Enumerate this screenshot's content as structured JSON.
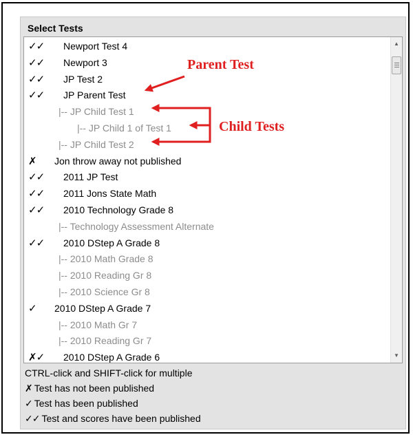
{
  "panel": {
    "title": "Select Tests"
  },
  "tests": [
    {
      "mark": "✓✓",
      "label": "Newport Test 4",
      "level": "parent"
    },
    {
      "mark": "✓✓",
      "label": "Newport 3",
      "level": "parent"
    },
    {
      "mark": "✓✓",
      "label": "JP Test 2",
      "level": "parent"
    },
    {
      "mark": "✓✓",
      "label": "JP Parent Test",
      "level": "parent"
    },
    {
      "mark": "",
      "label": "|-- JP Child Test 1",
      "level": "child1"
    },
    {
      "mark": "",
      "label": "|-- JP Child 1 of Test 1",
      "level": "child2"
    },
    {
      "mark": "",
      "label": "|-- JP Child Test 2",
      "level": "child1"
    },
    {
      "mark": "✗",
      "label": "Jon throw away not published",
      "level": "single"
    },
    {
      "mark": "✓✓",
      "label": "2011 JP Test",
      "level": "parent"
    },
    {
      "mark": "✓✓",
      "label": "2011 Jons State Math",
      "level": "parent"
    },
    {
      "mark": "✓✓",
      "label": "2010 Technology Grade 8",
      "level": "parent"
    },
    {
      "mark": "",
      "label": "|-- Technology Assessment Alternate",
      "level": "child1"
    },
    {
      "mark": "✓✓",
      "label": "2010 DStep A Grade 8",
      "level": "parent"
    },
    {
      "mark": "",
      "label": "|-- 2010 Math Grade 8",
      "level": "child1"
    },
    {
      "mark": "",
      "label": "|-- 2010 Reading Gr 8",
      "level": "child1"
    },
    {
      "mark": "",
      "label": "|-- 2010 Science Gr 8",
      "level": "child1"
    },
    {
      "mark": "✓",
      "label": "2010 DStep A Grade 7",
      "level": "single"
    },
    {
      "mark": "",
      "label": "|-- 2010 Math Gr 7",
      "level": "child1"
    },
    {
      "mark": "",
      "label": "|-- 2010 Reading Gr 7",
      "level": "child1"
    },
    {
      "mark": "✗✓",
      "label": "2010 DStep A Grade 6",
      "level": "parent"
    }
  ],
  "instructions": "CTRL-click and SHIFT-click for multiple",
  "legend": [
    {
      "mark": "✗",
      "text": "Test has not been published"
    },
    {
      "mark": "✓",
      "text": "Test has been published"
    },
    {
      "mark": "✓✓",
      "text": "Test and scores have been published"
    }
  ],
  "annotations": {
    "parent": "Parent Test",
    "children": "Child Tests",
    "color": "#e02020"
  },
  "icons": {
    "scroll_up": "scroll-up-arrow",
    "scroll_down": "scroll-down-arrow",
    "thumb": "scroll-thumb-grip"
  }
}
